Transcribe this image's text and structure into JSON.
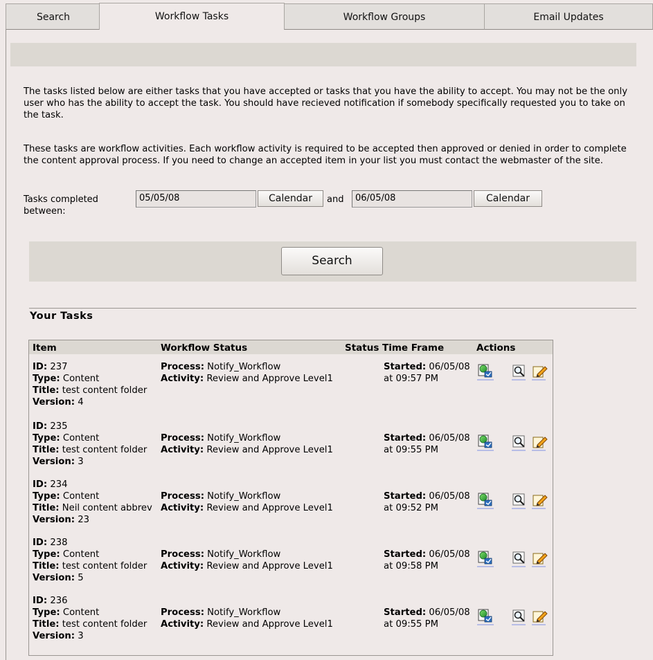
{
  "tabs": [
    {
      "label": "Search"
    },
    {
      "label": "Workflow Tasks"
    },
    {
      "label": "Workflow Groups"
    },
    {
      "label": "Email Updates"
    }
  ],
  "intro": {
    "para1": "The tasks listed below are either tasks that you have accepted or tasks that you have the ability to accept. You may not be the only user who has the ability to accept the task. You should have recieved notification if somebody specifically requested you to take on the task.",
    "para2": "These tasks are workflow activities. Each workflow activity is required to be accepted then approved or denied in order to complete the content approval process. If you need to change an accepted item in your list you must contact the webmaster of the site."
  },
  "filter": {
    "label": "Tasks completed between:",
    "start_date": "05/05/08",
    "end_date": "06/05/08",
    "calendar_label": "Calendar",
    "and_text": "and",
    "search_label": "Search"
  },
  "tasks": {
    "heading": "Your Tasks",
    "columns": {
      "item": "Item",
      "workflow_status": "Workflow Status",
      "status": "Status",
      "time_frame": "Time Frame",
      "actions": "Actions"
    },
    "labels": {
      "id": "ID:",
      "type": "Type:",
      "title": "Title:",
      "version": "Version:",
      "process": "Process:",
      "activity": "Activity:",
      "started": "Started:"
    },
    "rows": [
      {
        "id": "237",
        "type": "Content",
        "title": "test content folder",
        "version": "4",
        "process": "Notify_Workflow",
        "activity": "Review and Approve Level1",
        "started_date": "06/05/08",
        "started_time": "at 09:57 PM"
      },
      {
        "id": "235",
        "type": "Content",
        "title": "test content folder",
        "version": "3",
        "process": "Notify_Workflow",
        "activity": "Review and Approve Level1",
        "started_date": "06/05/08",
        "started_time": "at 09:55 PM"
      },
      {
        "id": "234",
        "type": "Content",
        "title": "Neil content abbrev",
        "version": "23",
        "process": "Notify_Workflow",
        "activity": "Review and Approve Level1",
        "started_date": "06/05/08",
        "started_time": "at 09:52 PM"
      },
      {
        "id": "238",
        "type": "Content",
        "title": "test content folder",
        "version": "5",
        "process": "Notify_Workflow",
        "activity": "Review and Approve Level1",
        "started_date": "06/05/08",
        "started_time": "at 09:58 PM"
      },
      {
        "id": "236",
        "type": "Content",
        "title": "test content folder",
        "version": "3",
        "process": "Notify_Workflow",
        "activity": "Review and Approve Level1",
        "started_date": "06/05/08",
        "started_time": "at 09:55 PM"
      }
    ],
    "action_icons": [
      "accept-task-icon",
      "preview-icon",
      "edit-icon"
    ]
  }
}
